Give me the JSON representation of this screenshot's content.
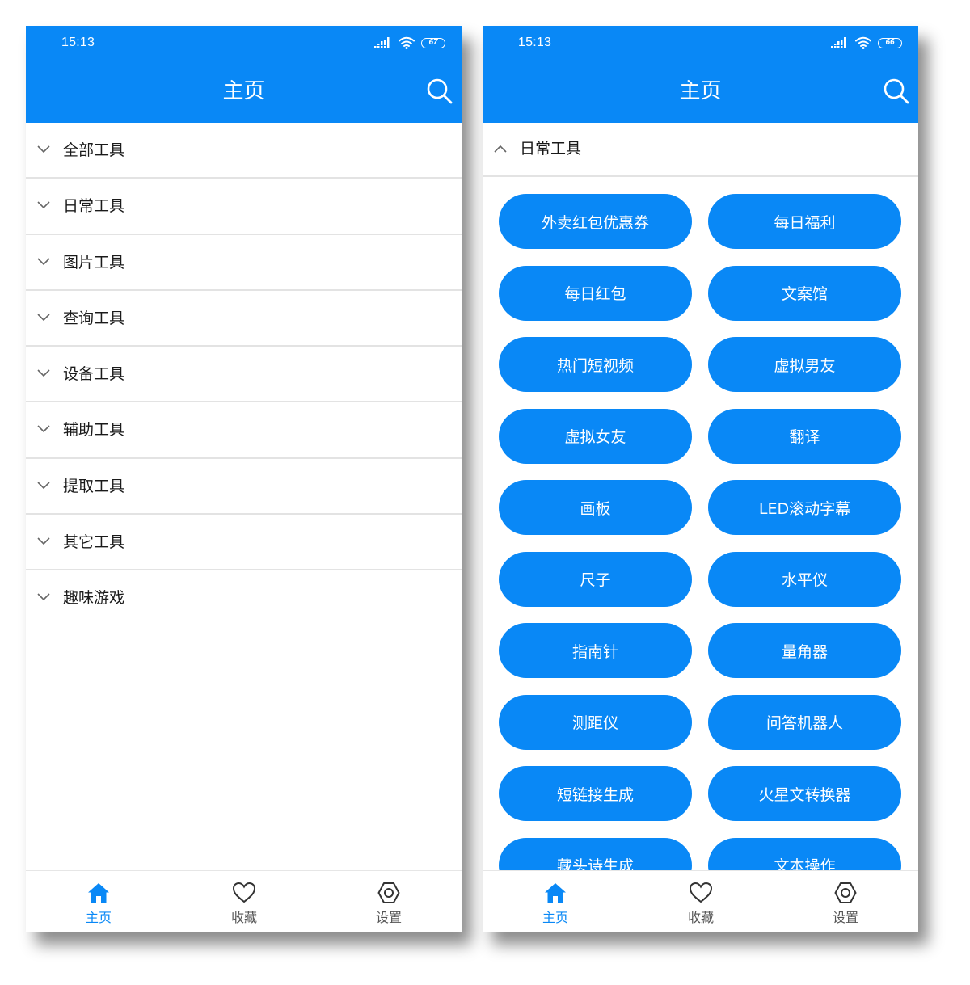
{
  "colors": {
    "accent": "#0988f6",
    "text": "#1a1a1a",
    "divider": "#e3e3e3",
    "inactive": "#555555"
  },
  "left_screen": {
    "status": {
      "time": "15:13",
      "battery": "67"
    },
    "header": {
      "title": "主页",
      "search_icon": "search-icon"
    },
    "categories": [
      {
        "label": "全部工具"
      },
      {
        "label": "日常工具"
      },
      {
        "label": "图片工具"
      },
      {
        "label": "查询工具"
      },
      {
        "label": "设备工具"
      },
      {
        "label": "辅助工具"
      },
      {
        "label": "提取工具"
      },
      {
        "label": "其它工具"
      },
      {
        "label": "趣味游戏"
      }
    ],
    "nav": [
      {
        "label": "主页",
        "icon": "home-icon",
        "active": true
      },
      {
        "label": "收藏",
        "icon": "heart-icon",
        "active": false
      },
      {
        "label": "设置",
        "icon": "settings-icon",
        "active": false
      }
    ]
  },
  "right_screen": {
    "status": {
      "time": "15:13",
      "battery": "66"
    },
    "header": {
      "title": "主页",
      "search_icon": "search-icon"
    },
    "section": {
      "label": "日常工具",
      "expanded": true
    },
    "tools": [
      "外卖红包优惠券",
      "每日福利",
      "每日红包",
      "文案馆",
      "热门短视频",
      "虚拟男友",
      "虚拟女友",
      "翻译",
      "画板",
      "LED滚动字幕",
      "尺子",
      "水平仪",
      "指南针",
      "量角器",
      "测距仪",
      "问答机器人",
      "短链接生成",
      "火星文转换器",
      "藏头诗生成",
      "文本操作"
    ],
    "nav": [
      {
        "label": "主页",
        "icon": "home-icon",
        "active": true
      },
      {
        "label": "收藏",
        "icon": "heart-icon",
        "active": false
      },
      {
        "label": "设置",
        "icon": "settings-icon",
        "active": false
      }
    ]
  }
}
